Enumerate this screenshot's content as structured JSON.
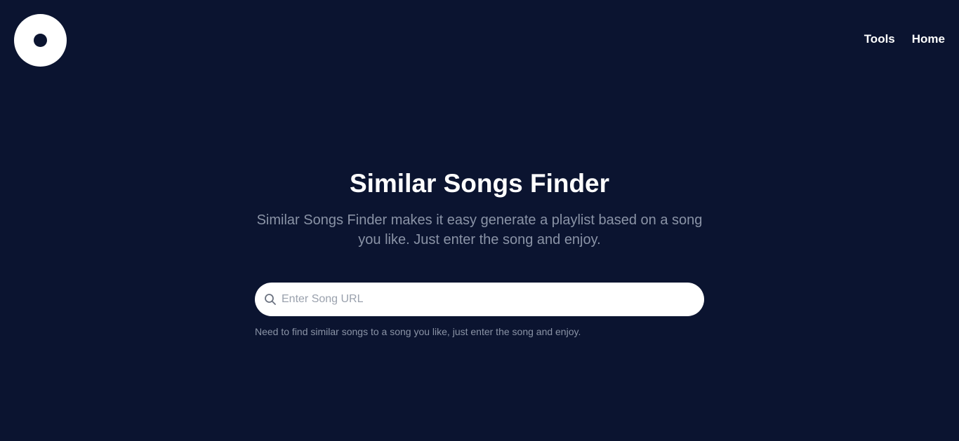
{
  "header": {
    "logo_icon": "vinyl-disc-icon",
    "nav": [
      {
        "label": "Tools"
      },
      {
        "label": "Home"
      }
    ]
  },
  "hero": {
    "title": "Similar Songs Finder",
    "subtitle": "Similar Songs Finder makes it easy generate a playlist based on a song you like. Just enter the song and enjoy."
  },
  "search": {
    "icon": "search-icon",
    "placeholder": "Enter Song URL",
    "value": ""
  },
  "hint": "Need to find similar songs to a song you like, just enter the song and enjoy.",
  "colors": {
    "background": "#0b1430",
    "foreground": "#ffffff",
    "muted_text": "#8a93a6"
  }
}
